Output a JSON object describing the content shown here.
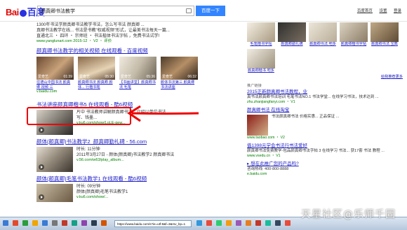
{
  "header": {
    "logo_part1": "Bai",
    "logo_part2": "百度",
    "search_value": "颜真卿书法教学",
    "search_button": "百度一下",
    "links": [
      "百度首页",
      "设置",
      "登录"
    ]
  },
  "result1": {
    "desc1": "1300年书法学颜真卿书法教学书法，怎么写书法 颜真卿 ...",
    "desc2": "真卿书法教学在线... 书法是书教\"权威视频\"形式，让最美书法每天一篇...",
    "desc3": "直通北三 ・ 四环 ・ 宗师班 ・ 书法楷体书法字帖 ，免费书法试学!",
    "url": "www.yanglunart.com 2015-12 ・ V2 ・ 评价"
  },
  "video_section": {
    "title": "颜真卿书法教学的相关视频 在线观看 - 百度视频",
    "thumbs": [
      {
        "caption": "往德山中国书法 颜真卿 视频 三",
        "src": "爱奇艺",
        "dur": "01:39"
      },
      {
        "caption": "颜真卿书法 颜真卿 颜体... 行楷书笔",
        "src": "爱奇艺",
        "dur": "05:30"
      },
      {
        "caption": "【书画讲堂】颜真卿书法 毛笔",
        "src": "爱奇艺",
        "dur": "05:36"
      },
      {
        "caption": "颜体书法第三 颜真卿 书法讲座",
        "src": "爱奇艺",
        "dur": "06:32"
      }
    ],
    "url": "v.baidu.com"
  },
  "highlighted_result": {
    "title": "书法讲座颜真卿楷书5 在线观看 - 酷6视频",
    "desc1": "片中 书法教师讲解颜真卿书法，介绍以单位书法...",
    "desc2": "写、钱墨...",
    "url": "v.ku6.com/show/LoLE-gew..."
  },
  "result3": {
    "title": "颜体(颜真卿)书法教学2_颜真卿勤礼碑 - 56.com",
    "lines": [
      "时长: 11分钟",
      "2011年3月27日 - 颜体(颜真卿)书法教学2 颜真卿书法",
      "v.56.com/w63/play_album..."
    ]
  },
  "result4": {
    "title": "颜体(颜真卿)毛笔书法教学1 在线观看 - 酷6视频",
    "lines": [
      "时长: 09分钟",
      "颜体(颜真卿)毛笔书法教学1",
      "v.ku6.com/show/..."
    ]
  },
  "right_panel": {
    "gallery_captions": [
      "毛笔楷书字帖",
      "颜真卿勤礼碑",
      "颜真卿书法 吧多",
      "颜真卿楷书字帖",
      "颜真卿书法 宝典",
      "颜真卿楷书 吧多"
    ],
    "more_link": "给我推荐更多",
    "ads_label": "推广链接",
    "ads": [
      {
        "title": "2015正新颜真卿书法教程，业",
        "desc": "真书法颜真卿书法培训 毛笔书法NO.1 书法学堂... 在线学习书法，技术达到 ...",
        "url": "zhu.zhanjiangfanyi.com ・ V1"
      },
      {
        "title": "颜真卿书法 在线淘宝",
        "desc": "书法颜真卿书法 价格实惠... 正品保证 ...",
        "url": "www.taobao.com ・ V2"
      },
      {
        "title": "值1398元学会书法行书法爱好",
        "desc": "颜真卿书法免费教学-包品颜真卿书法字帖 3 在线学习 书法... 获17套 书法 教程 ...",
        "url": "www.vsedu.cn ・ V1"
      },
      {
        "title": "▸ 想在此推广您的产品吗?",
        "desc": "咨询热线: 400-800-8888",
        "url": "e.baidu.com"
      }
    ]
  },
  "taskbar": {
    "address": "https://www.baidu.com/s?ie=utf-8&f=3&rsv_bp=1"
  },
  "watermark": "天星社区@乐师千固"
}
